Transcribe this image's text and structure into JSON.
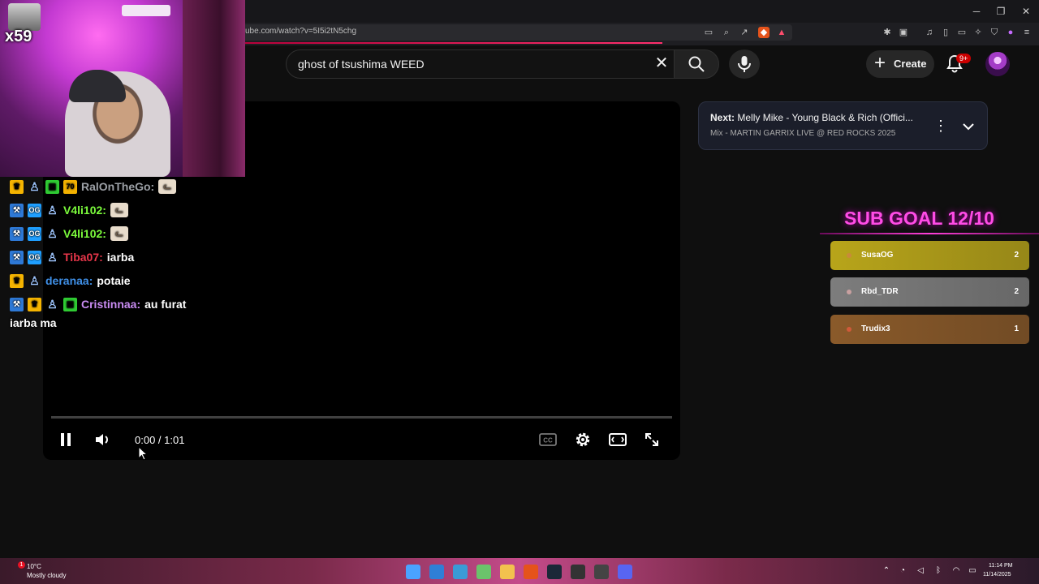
{
  "browser": {
    "url": "ube.com/watch?v=5I5i2tN5chg"
  },
  "youtube": {
    "search_query": "ghost of tsushima WEED",
    "create_label": "Create",
    "notification_badge": "9+",
    "player": {
      "time": "0:00 / 1:01",
      "progress_fraction": 0.0
    },
    "upnext": {
      "prefix": "Next:",
      "title": "Melly Mike - Young Black & Rich (Offici...",
      "subtitle": "Mix - MARTIN GARRIX LIVE @ RED ROCKS 2025"
    }
  },
  "webcam": {
    "badge": "x59"
  },
  "chat": [
    {
      "user": "RalOnTheGo:",
      "user_color": "#9ca0a6",
      "message": "",
      "emote": "cat"
    },
    {
      "user": "V4li102:",
      "user_color": "#7cfc3c",
      "message": "",
      "emote": "cat"
    },
    {
      "user": "V4li102:",
      "user_color": "#7cfc3c",
      "message": "",
      "emote": "cat"
    },
    {
      "user": "Tiba07:",
      "user_color": "#e8364a",
      "message": "iarba"
    },
    {
      "user": "deranaa:",
      "user_color": "#3f8fe6",
      "message": "potaie"
    },
    {
      "user": "Cristinnaa:",
      "user_color": "#c98cf2",
      "message": "au furat",
      "message_cont": "iarba ma"
    }
  ],
  "sub_goal": {
    "title": "SUB GOAL 12/10",
    "rows": [
      {
        "name": "SusaOG",
        "count": "2",
        "color": "#b8a51a"
      },
      {
        "name": "Rbd_TDR",
        "count": "2",
        "color": "#7d7d7d"
      },
      {
        "name": "Trudix3",
        "count": "1",
        "color": "#8a5a2a"
      }
    ]
  },
  "taskbar": {
    "weather_temp": "10°C",
    "weather_condition": "Mostly cloudy",
    "weather_alert": "1",
    "time": "11:14 PM",
    "date": "11/14/2025"
  }
}
